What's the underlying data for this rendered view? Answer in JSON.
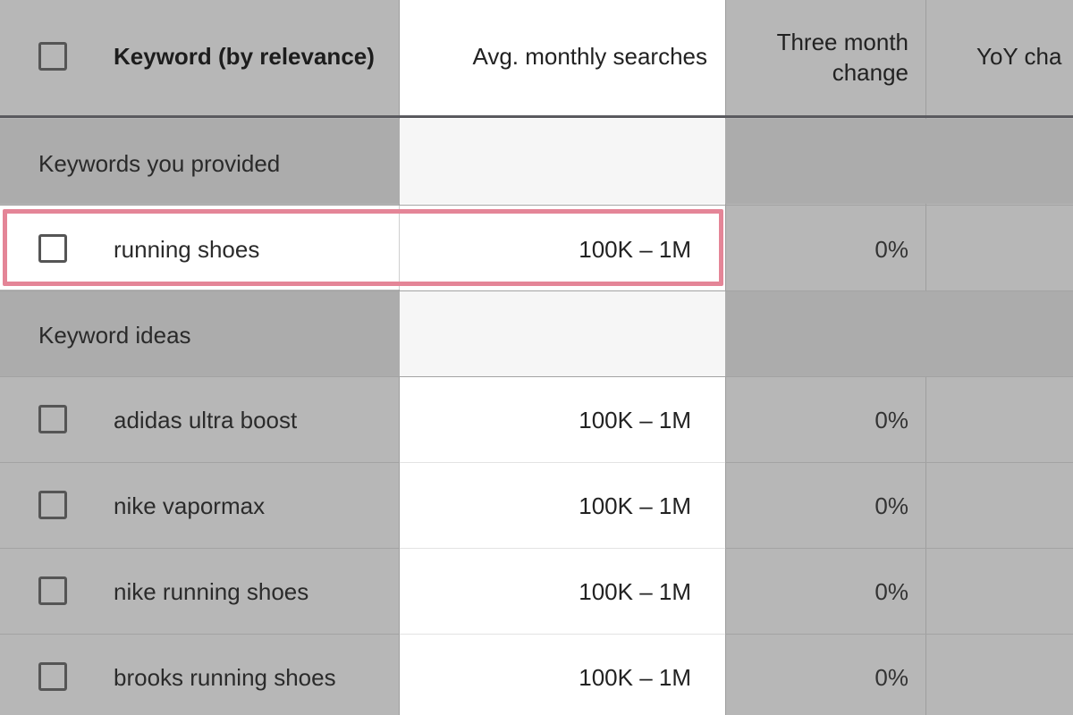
{
  "header": {
    "keyword": "Keyword (by relevance)",
    "avg_searches": "Avg. monthly searches",
    "three_month": "Three month change",
    "yoy": "YoY cha"
  },
  "groups": {
    "provided": "Keywords you provided",
    "ideas": "Keyword ideas"
  },
  "provided_rows": [
    {
      "keyword": "running shoes",
      "avg": "100K – 1M",
      "change": "0%",
      "highlighted": true
    }
  ],
  "idea_rows": [
    {
      "keyword": "adidas ultra boost",
      "avg": "100K – 1M",
      "change": "0%"
    },
    {
      "keyword": "nike vapormax",
      "avg": "100K – 1M",
      "change": "0%"
    },
    {
      "keyword": "nike running shoes",
      "avg": "100K – 1M",
      "change": "0%"
    },
    {
      "keyword": "brooks running shoes",
      "avg": "100K – 1M",
      "change": "0%"
    }
  ],
  "colors": {
    "highlight_outline": "#e48597",
    "highlight_column": "#ffffff",
    "table_bg": "#b7b7b7"
  }
}
